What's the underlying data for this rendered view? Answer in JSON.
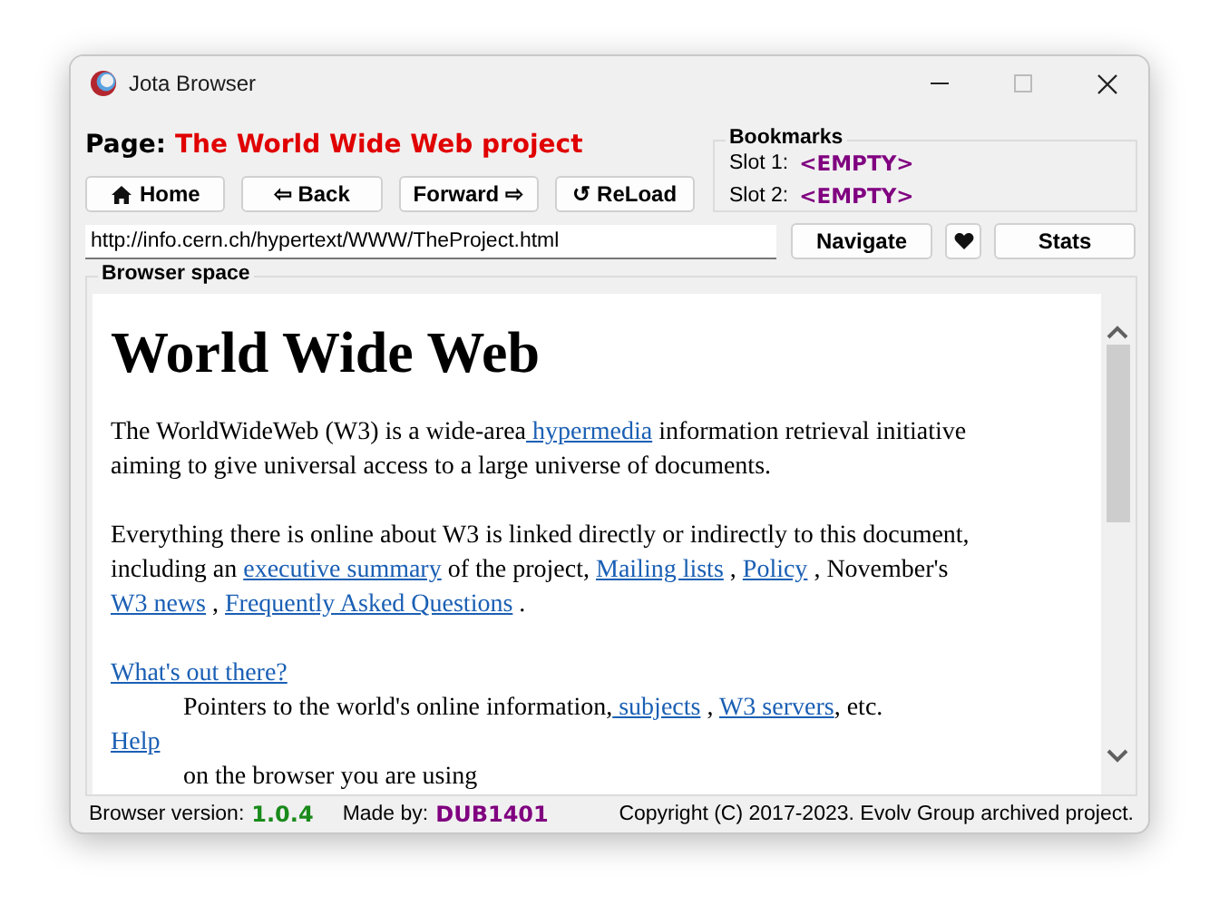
{
  "window": {
    "title": "Jota Browser"
  },
  "page": {
    "label": "Page:",
    "title": "The World Wide Web project"
  },
  "nav_buttons": [
    {
      "kind": "home",
      "label": "Home"
    },
    {
      "kind": "text",
      "label": "⇦ Back"
    },
    {
      "kind": "text",
      "label": "Forward ⇨"
    },
    {
      "kind": "text",
      "label": "↺ ReLoad"
    }
  ],
  "bookmarks": {
    "title": "Bookmarks",
    "slots": [
      {
        "label": "Slot 1:",
        "value": "<EMPTY>"
      },
      {
        "label": "Slot 2:",
        "value": "<EMPTY>"
      }
    ]
  },
  "address": {
    "value": "http://info.cern.ch/hypertext/WWW/TheProject.html"
  },
  "address_buttons": [
    {
      "kind": "text",
      "label": "Navigate"
    },
    {
      "kind": "heart"
    },
    {
      "kind": "text",
      "label": "Stats"
    }
  ],
  "browser_space": {
    "title": "Browser space",
    "heading": "World Wide Web",
    "blocks": [
      {
        "kind": "p",
        "segments": [
          {
            "kind": "text",
            "text": "The WorldWideWeb (W3) is a wide-area"
          },
          {
            "kind": "link",
            "text": " hypermedia"
          },
          {
            "kind": "text",
            "text": " information retrieval initiative aiming to give universal access to a large universe of documents."
          }
        ]
      },
      {
        "kind": "p",
        "segments": [
          {
            "kind": "text",
            "text": "Everything there is online about W3 is linked directly or indirectly to this document, including an "
          },
          {
            "kind": "link",
            "text": "executive summary"
          },
          {
            "kind": "text",
            "text": " of the project, "
          },
          {
            "kind": "link",
            "text": "Mailing lists"
          },
          {
            "kind": "text",
            "text": " , "
          },
          {
            "kind": "link",
            "text": "Policy"
          },
          {
            "kind": "text",
            "text": " , November's "
          },
          {
            "kind": "link",
            "text": "W3 news"
          },
          {
            "kind": "text",
            "text": " , "
          },
          {
            "kind": "link",
            "text": "Frequently Asked Questions"
          },
          {
            "kind": "text",
            "text": " ."
          }
        ]
      },
      {
        "kind": "dt",
        "segments": [
          {
            "kind": "link",
            "text": "What's out there?"
          }
        ]
      },
      {
        "kind": "dd",
        "segments": [
          {
            "kind": "text",
            "text": "Pointers to the world's online information,"
          },
          {
            "kind": "link",
            "text": " subjects"
          },
          {
            "kind": "text",
            "text": " , "
          },
          {
            "kind": "link",
            "text": "W3 servers"
          },
          {
            "kind": "text",
            "text": ", etc."
          }
        ]
      },
      {
        "kind": "dt",
        "segments": [
          {
            "kind": "link",
            "text": "Help"
          }
        ]
      },
      {
        "kind": "dd",
        "segments": [
          {
            "kind": "text",
            "text": "on the browser you are using"
          }
        ]
      }
    ]
  },
  "status_bar": {
    "version_label": "Browser version:",
    "version": "1.0.4",
    "author_label": "Made by:",
    "author": "DUB1401",
    "copyright": "Copyright (C) 2017-2023. Evolv Group archived project."
  }
}
